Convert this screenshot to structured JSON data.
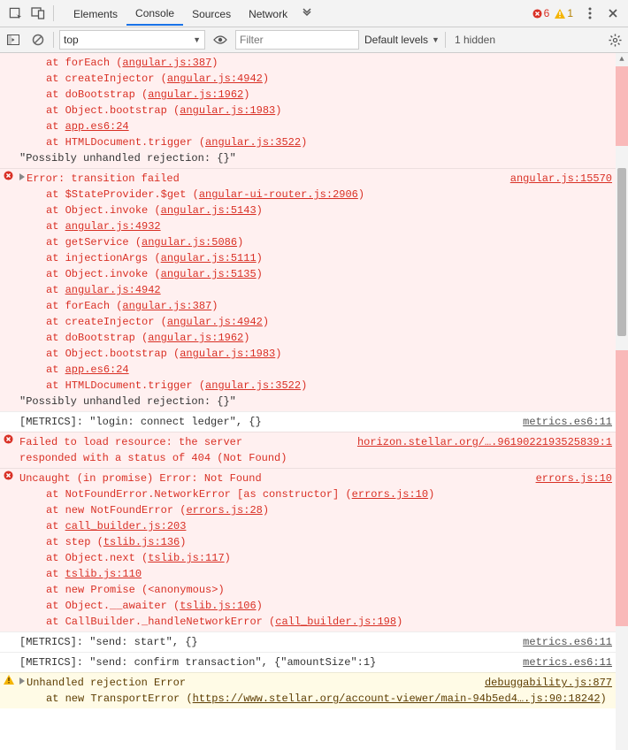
{
  "tabbar": {
    "tabs": [
      "Elements",
      "Console",
      "Sources",
      "Network"
    ],
    "active_index": 1,
    "error_count": "6",
    "warning_count": "1"
  },
  "toolbar": {
    "context": "top",
    "filter_placeholder": "Filter",
    "levels": "Default levels",
    "hidden": "1 hidden"
  },
  "entries": [
    {
      "type": "err",
      "first_trunc": true,
      "stack": [
        {
          "fn": "forEach",
          "loc": "angular.js:387"
        },
        {
          "fn": "createInjector",
          "loc": "angular.js:4942"
        },
        {
          "fn": "doBootstrap",
          "loc": "angular.js:1962"
        },
        {
          "fn": "Object.bootstrap",
          "loc": "angular.js:1983"
        },
        {
          "loc": "app.es6:24"
        },
        {
          "fn": "HTMLDocument.trigger",
          "loc": "angular.js:3522"
        }
      ],
      "tail": "\"Possibly unhandled rejection: {}\""
    },
    {
      "type": "err",
      "icon": "error",
      "disclosure": true,
      "msg": "Error: transition failed",
      "src": "angular.js:15570",
      "stack": [
        {
          "fn": "$StateProvider.$get",
          "loc": "angular-ui-router.js:2906"
        },
        {
          "fn": "Object.invoke",
          "loc": "angular.js:5143"
        },
        {
          "loc": "angular.js:4932"
        },
        {
          "fn": "getService",
          "loc": "angular.js:5086"
        },
        {
          "fn": "injectionArgs",
          "loc": "angular.js:5111"
        },
        {
          "fn": "Object.invoke",
          "loc": "angular.js:5135"
        },
        {
          "loc": "angular.js:4942"
        },
        {
          "fn": "forEach",
          "loc": "angular.js:387"
        },
        {
          "fn": "createInjector",
          "loc": "angular.js:4942"
        },
        {
          "fn": "doBootstrap",
          "loc": "angular.js:1962"
        },
        {
          "fn": "Object.bootstrap",
          "loc": "angular.js:1983"
        },
        {
          "loc": "app.es6:24"
        },
        {
          "fn": "HTMLDocument.trigger",
          "loc": "angular.js:3522"
        }
      ],
      "tail": "\"Possibly unhandled rejection: {}\""
    },
    {
      "type": "info",
      "msg": "[METRICS]: \"login: connect ledger\", {}",
      "src": "metrics.es6:11"
    },
    {
      "type": "err",
      "icon": "error",
      "msg_2line": "Failed to load resource: the server responded with a status of 404 (Not Found)",
      "src": "horizon.stellar.org/….9619022193525839:1"
    },
    {
      "type": "err",
      "icon": "error",
      "msg": "Uncaught (in promise) Error: Not Found",
      "src": "errors.js:10",
      "stack": [
        {
          "fn": "NotFoundError.NetworkError [as constructor]",
          "loc": "errors.js:10"
        },
        {
          "fn": "new NotFoundError",
          "loc": "errors.js:28"
        },
        {
          "loc": "call_builder.js:203"
        },
        {
          "fn": "step",
          "loc": "tslib.js:136"
        },
        {
          "fn": "Object.next",
          "loc": "tslib.js:117"
        },
        {
          "loc": "tslib.js:110"
        },
        {
          "fn": "new Promise",
          "anon": true
        },
        {
          "fn": "Object.__awaiter",
          "loc": "tslib.js:106"
        },
        {
          "fn": "CallBuilder._handleNetworkError",
          "loc": "call_builder.js:198"
        }
      ]
    },
    {
      "type": "info",
      "msg": "[METRICS]: \"send: start\", {}",
      "src": "metrics.es6:11"
    },
    {
      "type": "info",
      "msg": "[METRICS]: \"send: confirm transaction\", {\"amountSize\":1}",
      "src": "metrics.es6:11"
    },
    {
      "type": "warn",
      "icon": "warning",
      "disclosure": true,
      "msg": "Unhandled rejection Error",
      "src": "debuggability.js:877",
      "stack": [
        {
          "fn": "new TransportError",
          "loc_wrap": "https://www.stellar.org/account-viewer/main-94b5ed4….js:90:18242"
        }
      ]
    }
  ]
}
